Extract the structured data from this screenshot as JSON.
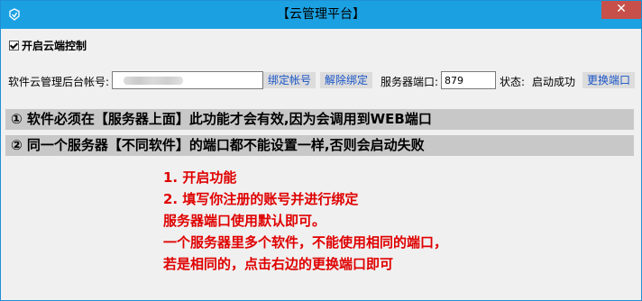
{
  "window": {
    "title": "【云管理平台】",
    "close_label": "✕"
  },
  "options": {
    "enable_cloud_control": {
      "label": "开启云端控制",
      "checked": true
    }
  },
  "form": {
    "account_label": "软件云管理后台帐号:",
    "account_value": "",
    "bind_account_button": "绑定帐号",
    "unbind_button": "解除绑定",
    "server_port_label": "服务器端口:",
    "server_port_value": "879",
    "status_label": "状态:",
    "status_value": "启动成功",
    "change_port_button": "更换端口"
  },
  "notices": [
    "① 软件必须在【服务器上面】此功能才会有效,因为会调用到WEB端口",
    "② 同一个服务器【不同软件】的端口都不能设置一样,否则会启动失败"
  ],
  "instructions": [
    "1. 开启功能",
    "2. 填写你注册的账号并进行绑定",
    "服务器端口使用默认即可。",
    "一个服务器里多个软件，不能使用相同的端口，",
    "若是相同的，点击右边的更换端口即可"
  ],
  "colors": {
    "titlebar": "#1ba1e2",
    "close_button": "#c7504a",
    "button_text": "#1a55c7",
    "instruction_text": "#e00000"
  }
}
